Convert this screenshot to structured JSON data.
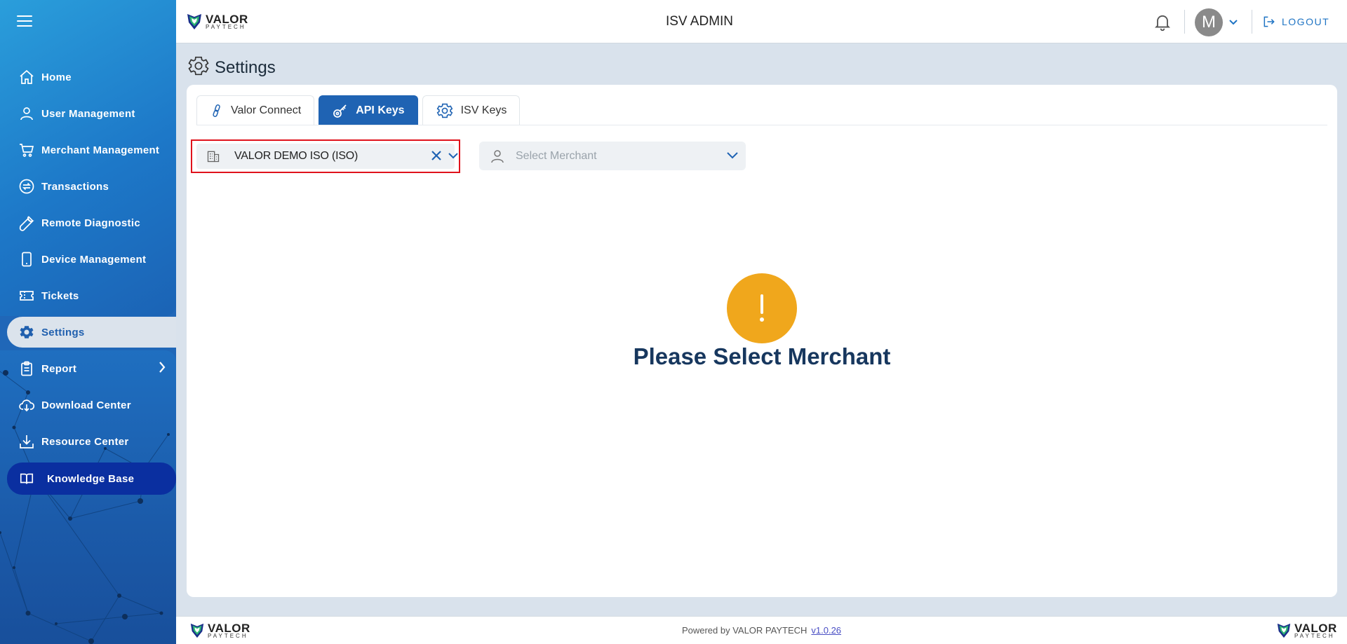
{
  "app": {
    "title": "ISV ADMIN"
  },
  "brand": {
    "name": "VALOR",
    "sub": "PAYTECH",
    "primary": "#1f63b3",
    "accent": "#2bb673"
  },
  "sidebar": {
    "items": [
      {
        "label": "Home",
        "icon": "home-icon"
      },
      {
        "label": "User Management",
        "icon": "user-icon"
      },
      {
        "label": "Merchant Management",
        "icon": "cart-icon"
      },
      {
        "label": "Transactions",
        "icon": "transfer-icon"
      },
      {
        "label": "Remote Diagnostic",
        "icon": "wrench-icon"
      },
      {
        "label": "Device Management",
        "icon": "device-icon"
      },
      {
        "label": "Tickets",
        "icon": "ticket-icon"
      },
      {
        "label": "Settings",
        "icon": "gear-icon",
        "active": true
      },
      {
        "label": "Report",
        "icon": "clipboard-icon"
      },
      {
        "label": "Download Center",
        "icon": "cloud-download-icon"
      },
      {
        "label": "Resource Center",
        "icon": "download-icon"
      },
      {
        "label": "Knowledge Base",
        "icon": "book-icon"
      }
    ]
  },
  "header": {
    "avatar_initial": "M",
    "logout_label": "LOGOUT"
  },
  "page": {
    "title": "Settings",
    "tabs": [
      {
        "label": "Valor Connect",
        "icon": "link-icon"
      },
      {
        "label": "API Keys",
        "icon": "key-icon",
        "active": true
      },
      {
        "label": "ISV Keys",
        "icon": "gear-icon"
      }
    ],
    "iso_select": {
      "value": "VALOR DEMO ISO (ISO)"
    },
    "merchant_select": {
      "placeholder": "Select Merchant"
    },
    "empty_state": {
      "icon": "!",
      "message": "Please Select Merchant",
      "color": "#f0a71c"
    }
  },
  "footer": {
    "powered_by": "Powered by VALOR PAYTECH",
    "version": "v1.0.26"
  }
}
